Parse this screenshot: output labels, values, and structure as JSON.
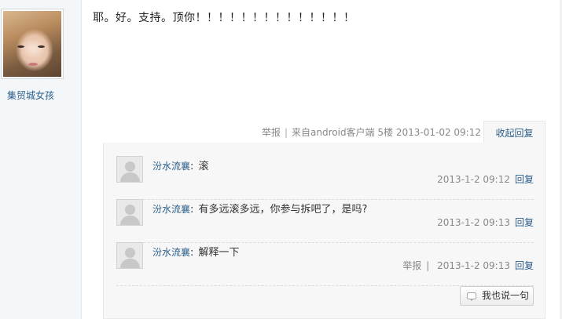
{
  "poster": {
    "username": "集贸城女孩"
  },
  "post": {
    "content": "耶。好。支持。顶你！！！！！！！！！！！！！！",
    "meta": {
      "report": "举报",
      "separator": "|",
      "source": "来自android客户端",
      "floor": "5楼",
      "timestamp": "2013-01-02 09:12"
    },
    "collapse_label": "收起回复"
  },
  "replies": [
    {
      "author": "汾水流襄",
      "colon": ":",
      "text": "滚",
      "time": "2013-1-2 09:12",
      "reply_label": "回复"
    },
    {
      "author": "汾水流襄",
      "colon": ":",
      "text": "有多远滚多远，你参与拆吧了，是吗?",
      "time": "2013-1-2 09:13",
      "reply_label": "回复"
    },
    {
      "author": "汾水流襄",
      "colon": ":",
      "text": "解释一下",
      "report": "举报",
      "separator": "|",
      "time": "2013-1-2 09:13",
      "reply_label": "回复"
    }
  ],
  "say_button_label": "我也说一句",
  "icons": {
    "say_button": "speech-bubble-icon",
    "reply_avatar": "default-user-icon"
  }
}
